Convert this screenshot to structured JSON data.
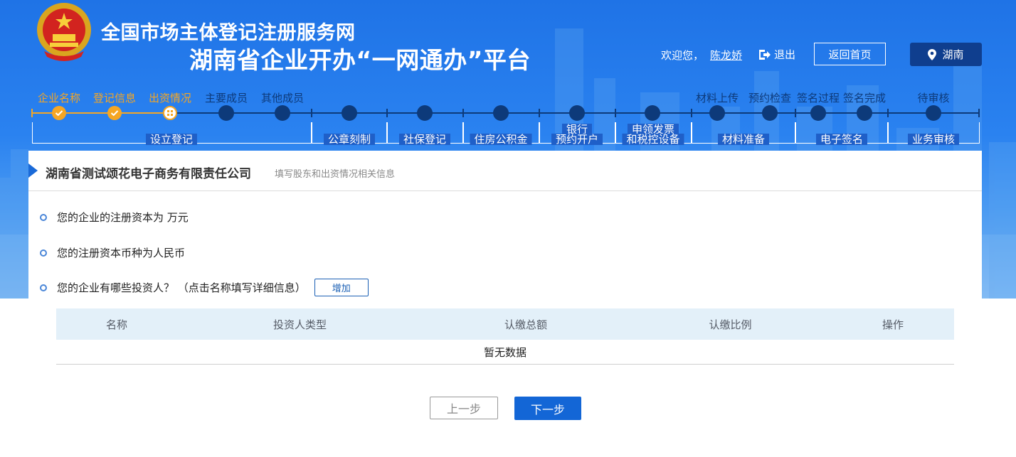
{
  "header": {
    "title_line1": "全国市场主体登记注册服务网",
    "title_line2": "湖南省企业开办“一网通办”平台",
    "welcome": "欢迎您，",
    "username": "陈龙娇",
    "logout_label": "退出",
    "home_label": "返回首页",
    "region_label": "湖南"
  },
  "steps": [
    {
      "label": "企业名称",
      "status": "done"
    },
    {
      "label": "登记信息",
      "status": "done"
    },
    {
      "label": "出资情况",
      "status": "current"
    },
    {
      "label": "主要成员",
      "status": "todo"
    },
    {
      "label": "其他成员",
      "status": "todo"
    },
    {
      "label": "",
      "status": "todo"
    },
    {
      "label": "",
      "status": "todo"
    },
    {
      "label": "",
      "status": "todo"
    },
    {
      "label": "",
      "status": "todo"
    },
    {
      "label": "",
      "status": "todo"
    },
    {
      "label": "材料上传",
      "status": "todo"
    },
    {
      "label": "预约检查",
      "status": "todo"
    },
    {
      "label": "签名过程",
      "status": "todo"
    },
    {
      "label": "签名完成",
      "status": "todo"
    },
    {
      "label": "待审核",
      "status": "todo"
    }
  ],
  "step_groups": [
    {
      "label": "设立登记"
    },
    {
      "label": "公章刻制"
    },
    {
      "label": "社保登记"
    },
    {
      "label": "住房公积金"
    },
    {
      "label_line1": "银行",
      "label_line2": "预约开户"
    },
    {
      "label_line1": "申领发票",
      "label_line2": "和税控设备"
    },
    {
      "label": "材料准备"
    },
    {
      "label": "电子签名"
    },
    {
      "label": "业务审核"
    }
  ],
  "panel": {
    "company": "湖南省测试颂花电子商务有限责任公司",
    "subtitle": "填写股东和出资情况相关信息",
    "q1": "您的企业的注册资本为 万元",
    "q2": "您的注册资本币种为人民币",
    "q3": "您的企业有哪些投资人？ （点击名称填写详细信息）",
    "add_label": "增加"
  },
  "table": {
    "columns": [
      "名称",
      "投资人类型",
      "认缴总额",
      "认缴比例",
      "操作"
    ],
    "empty_text": "暂无数据"
  },
  "footer": {
    "prev_label": "上一步",
    "next_label": "下一步"
  },
  "colors": {
    "done": "#f5a623",
    "pending": "#0d3a7a",
    "primary": "#1366d6"
  }
}
